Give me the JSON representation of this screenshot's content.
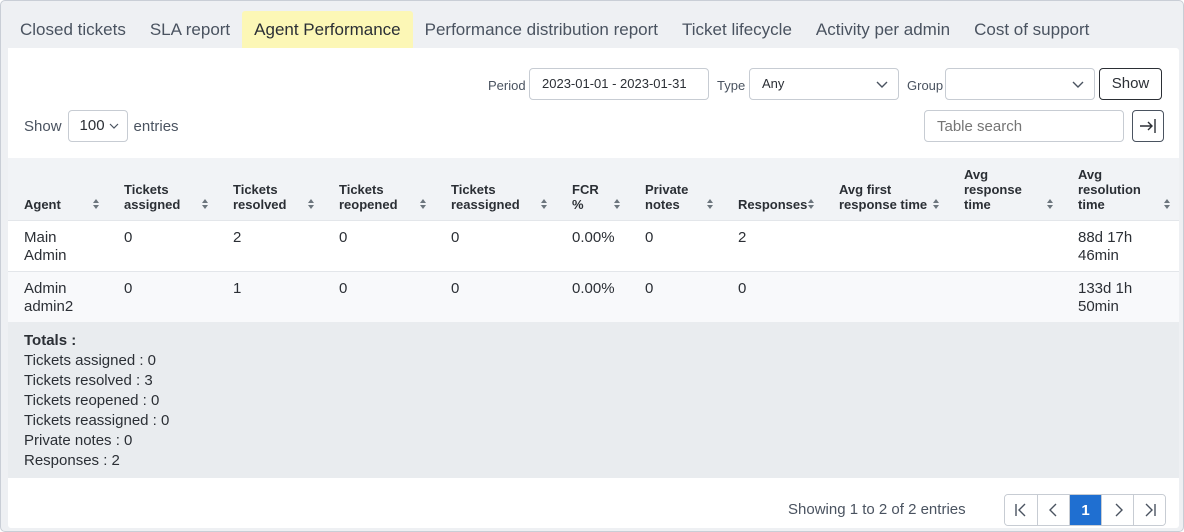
{
  "tabs": [
    {
      "label": "Closed tickets"
    },
    {
      "label": "SLA report"
    },
    {
      "label": "Agent Performance",
      "active": true
    },
    {
      "label": "Performance distribution report"
    },
    {
      "label": "Ticket lifecycle"
    },
    {
      "label": "Activity per admin"
    },
    {
      "label": "Cost of support"
    }
  ],
  "filters": {
    "period_label": "Period",
    "period_value": "2023-01-01 - 2023-01-31",
    "type_label": "Type",
    "type_value": "Any",
    "group_label": "Group",
    "group_value": "",
    "show_button": "Show"
  },
  "entries": {
    "show_label": "Show",
    "value": "100",
    "entries_label": "entries"
  },
  "search": {
    "placeholder": "Table search"
  },
  "export_icon": "export-icon",
  "table": {
    "headers": [
      {
        "l1": "",
        "l2": "",
        "l3": "Agent"
      },
      {
        "l1": "",
        "l2": "Tickets",
        "l3": "assigned"
      },
      {
        "l1": "",
        "l2": "Tickets",
        "l3": "resolved"
      },
      {
        "l1": "",
        "l2": "Tickets",
        "l3": "reopened"
      },
      {
        "l1": "",
        "l2": "Tickets",
        "l3": "reassigned"
      },
      {
        "l1": "",
        "l2": "FCR",
        "l3": "%"
      },
      {
        "l1": "",
        "l2": "Private",
        "l3": "notes"
      },
      {
        "l1": "",
        "l2": "",
        "l3": "Responses"
      },
      {
        "l1": "",
        "l2": "Avg first",
        "l3": "response time"
      },
      {
        "l1": "Avg",
        "l2": "response",
        "l3": "time"
      },
      {
        "l1": "Avg",
        "l2": "resolution",
        "l3": "time"
      }
    ],
    "rows": [
      {
        "agent": [
          "Main",
          "Admin"
        ],
        "assigned": "0",
        "resolved": "2",
        "reopened": "0",
        "reassigned": "0",
        "fcr": "0.00%",
        "notes": "0",
        "responses": "2",
        "avg_first": "",
        "avg_response": "",
        "avg_resolution": [
          "88d 17h",
          "46min"
        ]
      },
      {
        "agent": [
          "Admin",
          "admin2"
        ],
        "assigned": "0",
        "resolved": "1",
        "reopened": "0",
        "reassigned": "0",
        "fcr": "0.00%",
        "notes": "0",
        "responses": "0",
        "avg_first": "",
        "avg_response": "",
        "avg_resolution": [
          "133d 1h",
          "50min"
        ]
      }
    ]
  },
  "totals": {
    "title": "Totals :",
    "lines": [
      "Tickets assigned : 0",
      "Tickets resolved : 3",
      "Tickets reopened : 0",
      "Tickets reassigned : 0",
      "Private notes : 0",
      "Responses : 2"
    ]
  },
  "pagination": {
    "info": "Showing 1 to 2 of 2 entries",
    "current": "1"
  }
}
